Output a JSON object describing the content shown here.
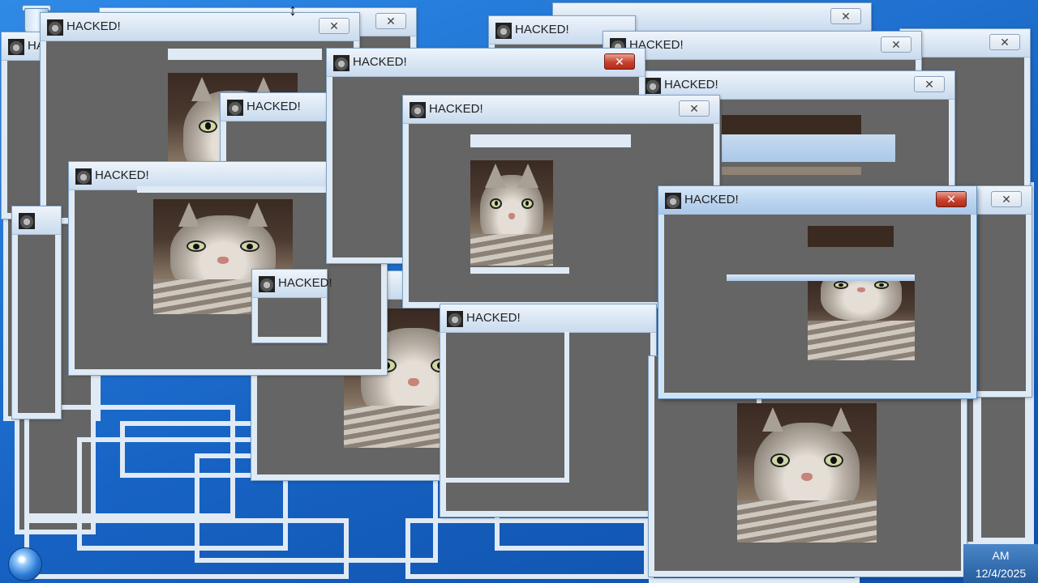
{
  "popup": {
    "title": "HACKED!",
    "close_glyph": "✕",
    "icon": "cat-thumbnail-icon"
  },
  "taskbar": {
    "time": "AM",
    "date": "12/4/2025"
  },
  "cursor_glyph": "↕",
  "colors": {
    "window_body": "#656565",
    "window_frame": "#dfeaf5",
    "close_active": "#c7422e",
    "desktop": "#1763c4"
  }
}
